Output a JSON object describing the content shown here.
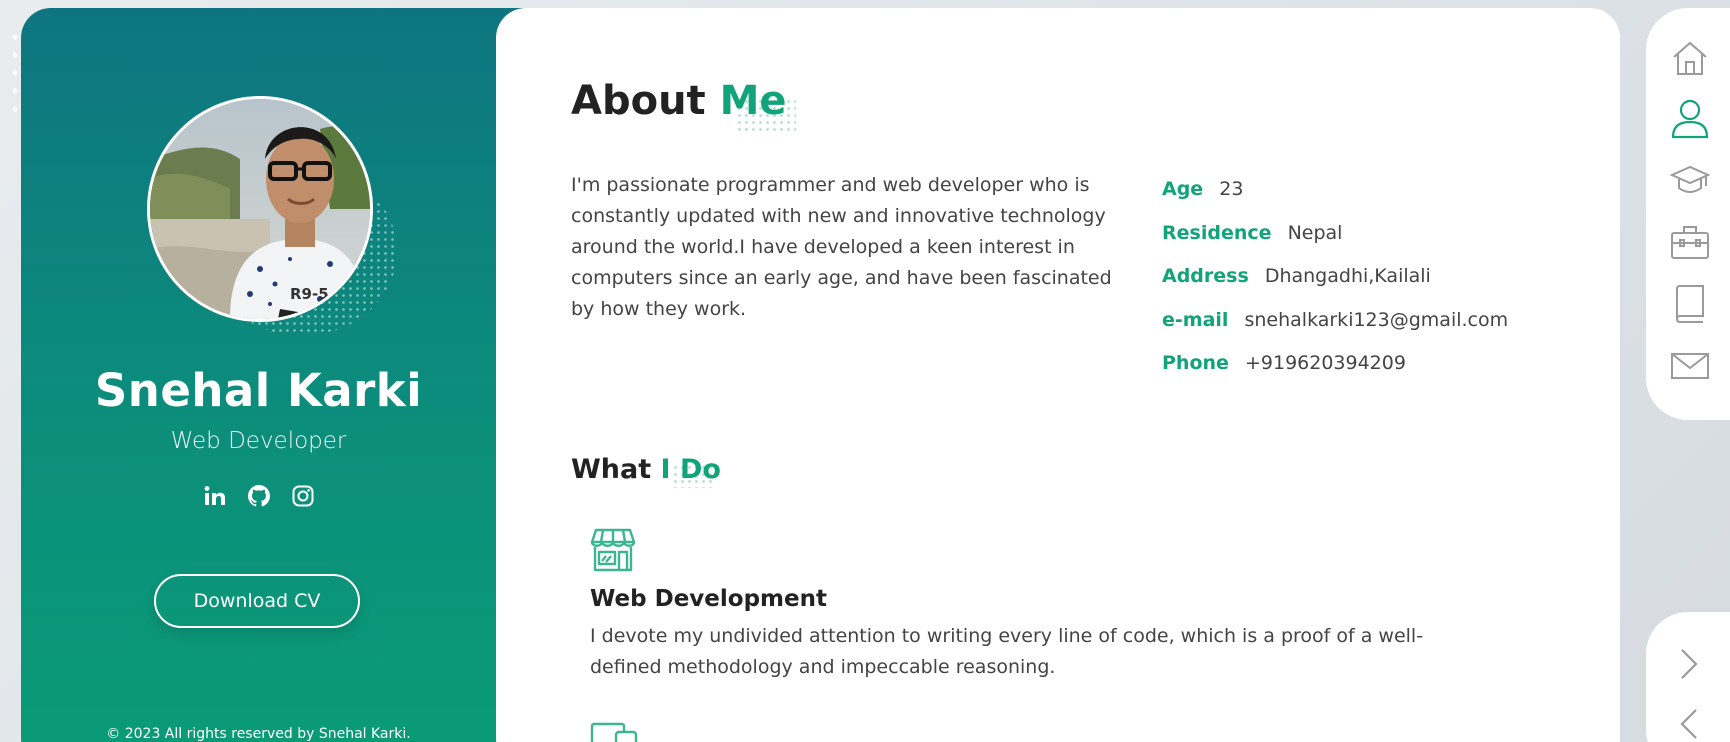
{
  "profile": {
    "name": "Snehal Karki",
    "role": "Web Developer",
    "download_label": "Download CV",
    "copyright": "© 2023 All rights reserved by Snehal Karki.",
    "socials": [
      "linkedin-icon",
      "github-icon",
      "instagram-icon"
    ]
  },
  "about": {
    "title_main": "About",
    "title_accent": "Me",
    "paragraph": "I'm passionate programmer and web developer who is constantly updated with new and innovative technology around the world.I have developed a keen interest in computers since an early age, and have been fascinated by how they work.",
    "info": [
      {
        "label": "Age",
        "value": "23"
      },
      {
        "label": "Residence",
        "value": "Nepal"
      },
      {
        "label": "Address",
        "value": "Dhangadhi,Kailali"
      },
      {
        "label": "e-mail",
        "value": "snehalkarki123@gmail.com"
      },
      {
        "label": "Phone",
        "value": "+919620394209"
      }
    ]
  },
  "services": {
    "title_main": "What",
    "title_accent": "I Do",
    "items": [
      {
        "icon": "store-icon",
        "title": "Web Development",
        "description": "I devote my undivided attention to writing every line of code, which is a proof of a well-defined methodology and impeccable reasoning."
      }
    ]
  },
  "nav": {
    "items": [
      "home-icon",
      "user-icon",
      "graduation-cap-icon",
      "briefcase-icon",
      "book-icon",
      "mail-icon"
    ],
    "active": "user-icon",
    "pager": [
      "chevron-right-icon",
      "chevron-left-icon"
    ]
  },
  "colors": {
    "accent": "#11a37a",
    "gradient_top": "#0e7580",
    "gradient_bottom": "#0a9c76",
    "nav_inactive": "#9a9a9a"
  }
}
